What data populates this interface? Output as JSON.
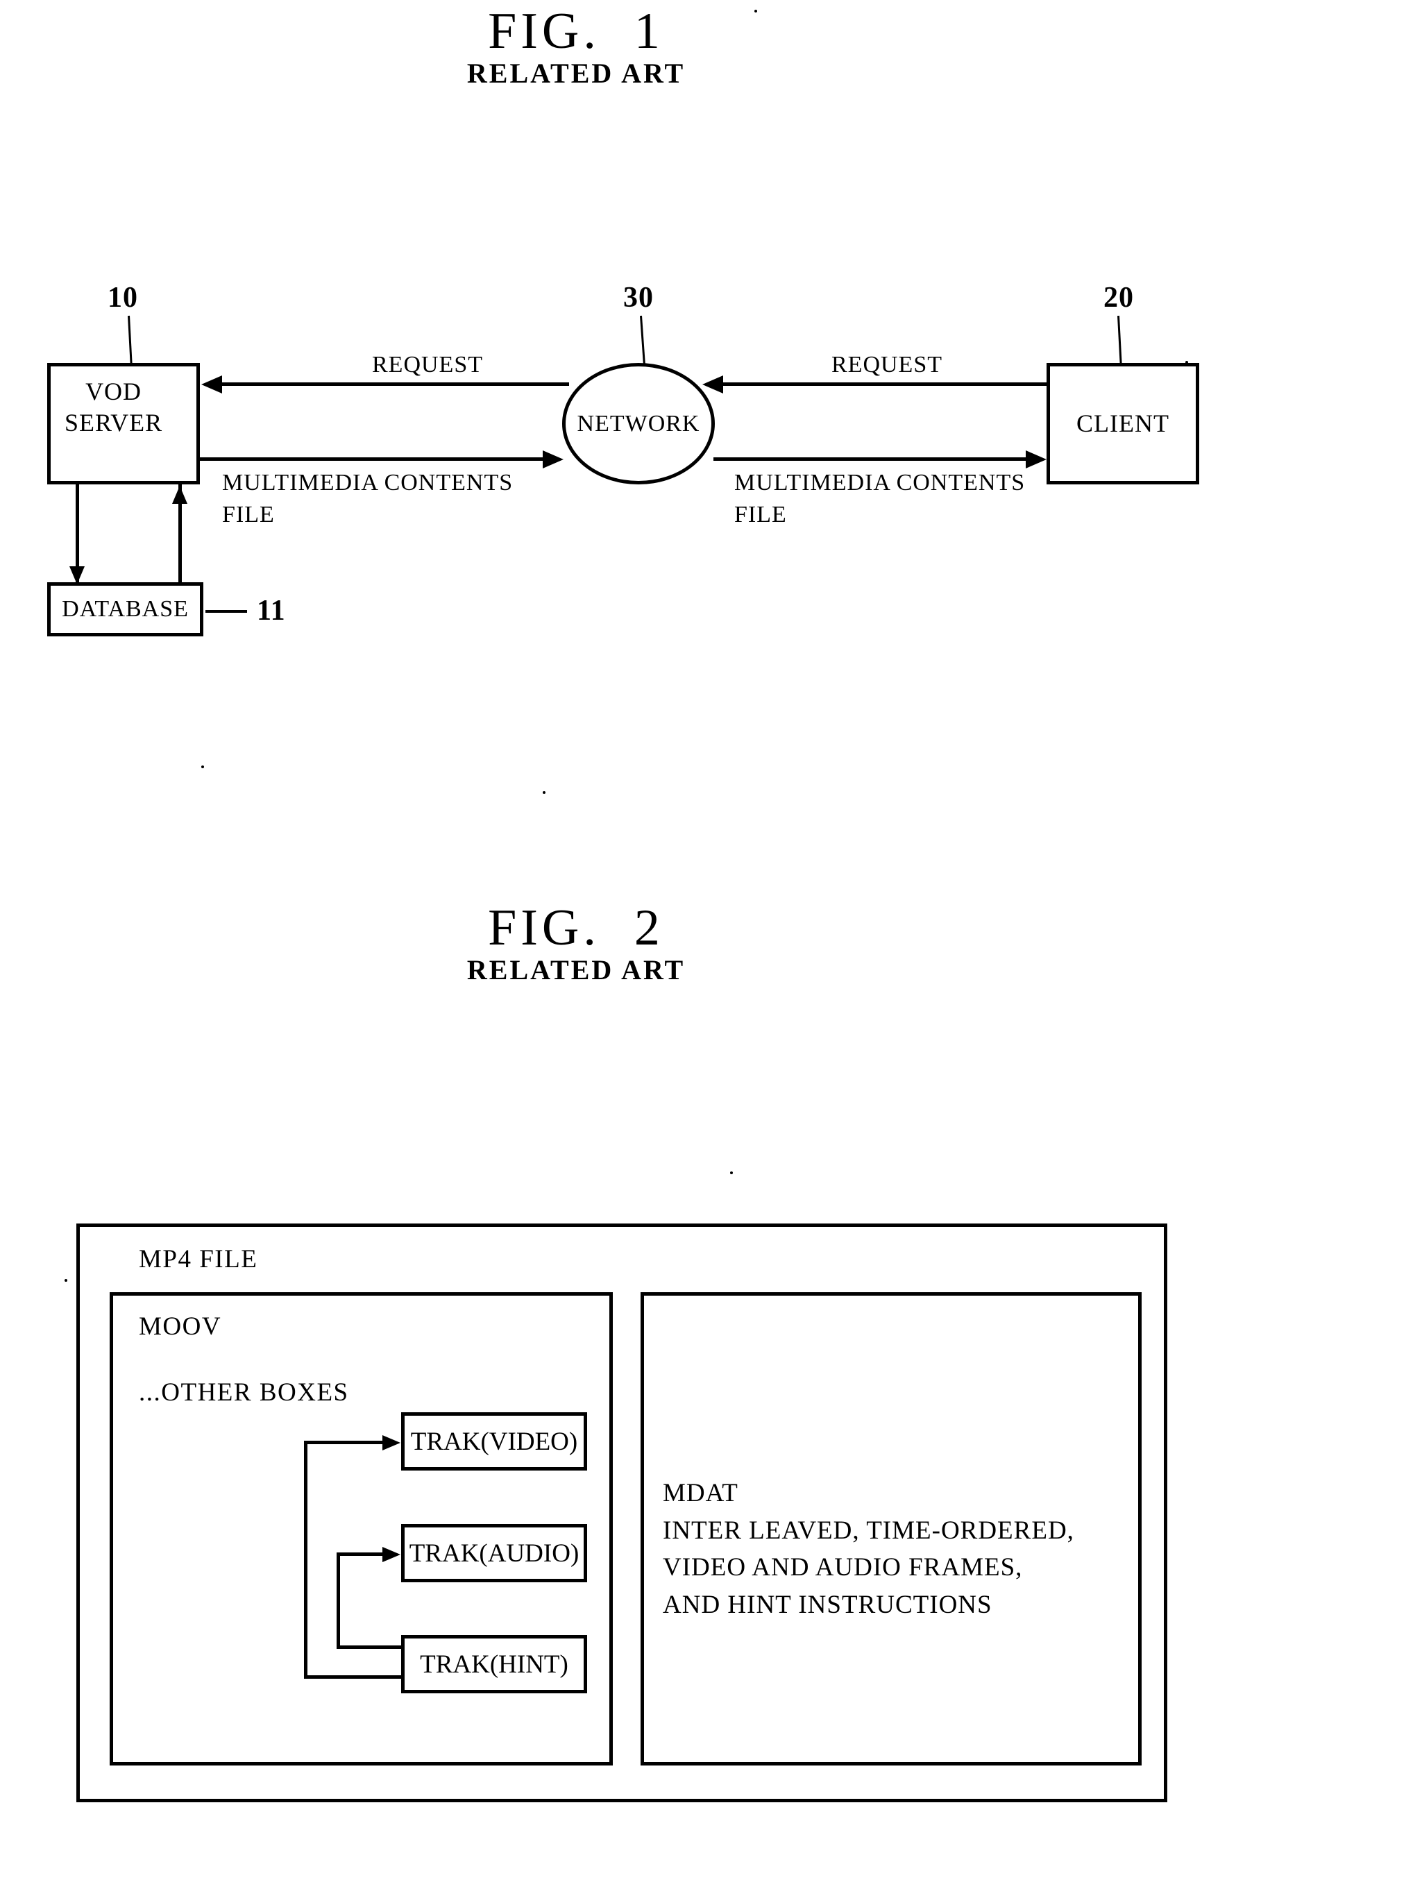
{
  "figures": [
    {
      "id": "fig1",
      "title": "FIG.  1",
      "subtitle": "RELATED ART",
      "nodes": {
        "vod_server": {
          "label": "VOD\nSERVER",
          "ref": "10"
        },
        "database": {
          "label": "DATABASE",
          "ref": "11"
        },
        "network": {
          "label": "NETWORK",
          "ref": "30"
        },
        "client": {
          "label": "CLIENT",
          "ref": "20"
        }
      },
      "edge_labels": {
        "request_left": "REQUEST",
        "request_right": "REQUEST",
        "contents_left": "MULTIMEDIA CONTENTS\nFILE",
        "contents_right": "MULTIMEDIA CONTENTS\nFILE"
      }
    },
    {
      "id": "fig2",
      "title": "FIG.  2",
      "subtitle": "RELATED ART",
      "outer_label": "MP4 FILE",
      "moov": {
        "title": "MOOV",
        "other_boxes": "...OTHER BOXES",
        "traks": [
          {
            "label": "TRAK(VIDEO)"
          },
          {
            "label": "TRAK(AUDIO)"
          },
          {
            "label": "TRAK(HINT)"
          }
        ]
      },
      "mdat": {
        "title": "MDAT",
        "description": "INTER LEAVED, TIME-ORDERED,\nVIDEO AND AUDIO FRAMES,\nAND HINT INSTRUCTIONS"
      }
    }
  ],
  "colors": {
    "ink": "#000000",
    "paper": "#ffffff"
  }
}
